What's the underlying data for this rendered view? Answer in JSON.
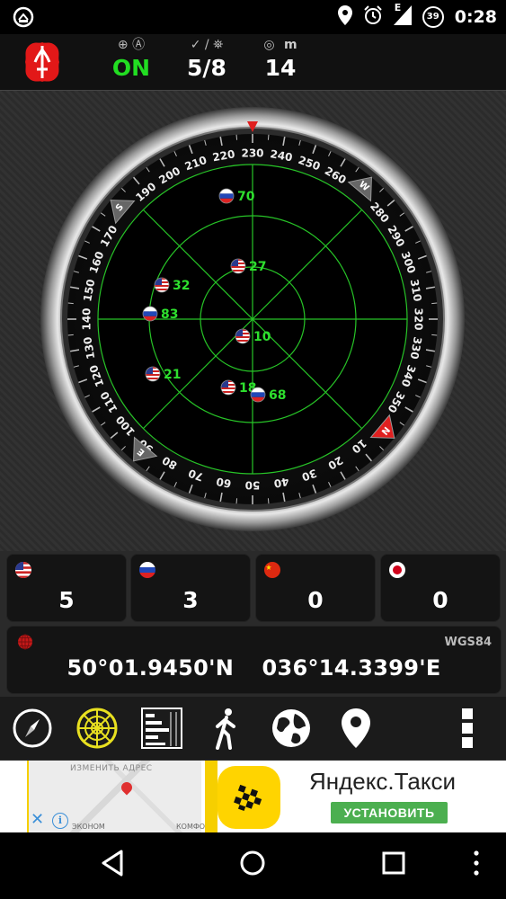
{
  "status_bar": {
    "time": "0:28",
    "battery_level": "39",
    "network_type": "E",
    "icons": [
      "speedometer-icon",
      "location-icon",
      "alarm-icon",
      "signal-icon",
      "battery-icon"
    ]
  },
  "header": {
    "gps_status": "ON",
    "satellites": "5/8",
    "accuracy": "14",
    "accuracy_unit": "m",
    "icons": [
      "gps-fix-icon",
      "check-icon",
      "satellite-icon",
      "target-icon"
    ]
  },
  "radar": {
    "compass_ticks": [
      "10",
      "20",
      "30",
      "40",
      "50",
      "60",
      "70",
      "80",
      "90",
      "100",
      "110",
      "120",
      "130",
      "140",
      "150",
      "160",
      "170",
      "190",
      "200",
      "210",
      "220",
      "230",
      "240",
      "250",
      "260",
      "280",
      "290",
      "300",
      "310",
      "320",
      "330",
      "340",
      "350"
    ],
    "cardinals": [
      "N",
      "E",
      "S",
      "W"
    ],
    "satellites": [
      {
        "id": "70",
        "flag": "ru"
      },
      {
        "id": "27",
        "flag": "us"
      },
      {
        "id": "32",
        "flag": "us"
      },
      {
        "id": "83",
        "flag": "ru"
      },
      {
        "id": "10",
        "flag": "us"
      },
      {
        "id": "21",
        "flag": "us"
      },
      {
        "id": "18",
        "flag": "us"
      },
      {
        "id": "68",
        "flag": "ru"
      }
    ],
    "grid_color": "#27c427",
    "label_color": "#2ee02e"
  },
  "constellations": [
    {
      "name": "us-flag-icon",
      "count": "5"
    },
    {
      "name": "ru-flag-icon",
      "count": "3"
    },
    {
      "name": "cn-flag-icon",
      "count": "0"
    },
    {
      "name": "jp-flag-icon",
      "count": "0"
    }
  ],
  "position": {
    "datum": "WGS84",
    "lat": "50°01.9450'N",
    "lon": "036°14.3399'E"
  },
  "toolbar": {
    "items": [
      "compass-icon",
      "radar-icon",
      "signal-bars-icon",
      "walk-icon",
      "globe-icon",
      "map-pin-icon",
      "more-icon"
    ]
  },
  "ad": {
    "map_hint": "ИЗМЕНИТЬ АДРЕС",
    "map_label_1": "ЭКОНОМ",
    "map_label_2": "КОМФО",
    "title": "Яндекс.Такси",
    "button": "УСТАНОВИТЬ"
  },
  "navbar": {
    "items": [
      "back-icon",
      "home-icon",
      "recents-icon",
      "menu-icon"
    ]
  },
  "colors": {
    "accent_green": "#22dd22",
    "panel": "#141414",
    "background": "#2a2a2a"
  }
}
